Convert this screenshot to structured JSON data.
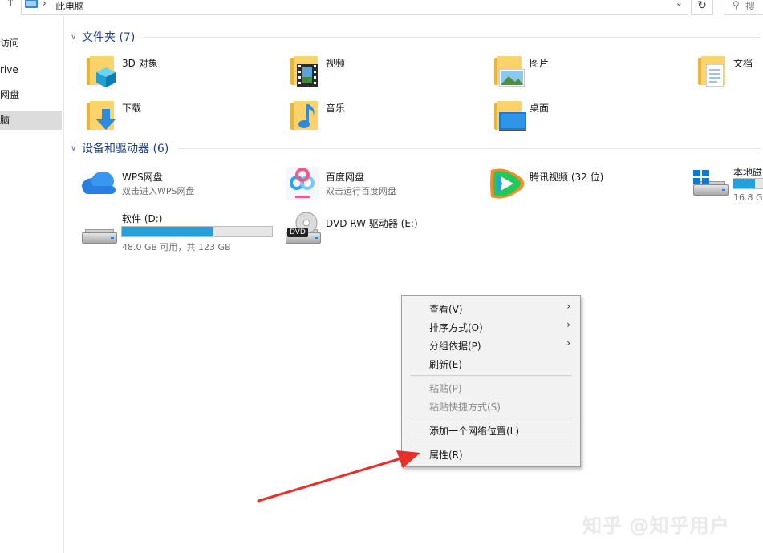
{
  "address": {
    "up_glyph": "↑",
    "separator": "›",
    "location": "此电脑",
    "dropdown_glyph": "⌄",
    "refresh_glyph": "↻",
    "search_glyph": "搜"
  },
  "nav": {
    "items": [
      {
        "label": "访问",
        "selected": false
      },
      {
        "label": "rive",
        "selected": false
      },
      {
        "label": "网盘",
        "selected": false
      },
      {
        "label": "脑",
        "selected": true
      }
    ]
  },
  "folders": {
    "header": "文件夹 (7)",
    "items": [
      {
        "label": "3D 对象",
        "icon": "3d-objects-icon"
      },
      {
        "label": "视频",
        "icon": "videos-icon"
      },
      {
        "label": "图片",
        "icon": "pictures-icon"
      },
      {
        "label": "文档",
        "icon": "documents-icon"
      },
      {
        "label": "下载",
        "icon": "downloads-icon"
      },
      {
        "label": "音乐",
        "icon": "music-icon"
      },
      {
        "label": "桌面",
        "icon": "desktop-icon"
      }
    ]
  },
  "devices": {
    "header": "设备和驱动器 (6)",
    "items": [
      {
        "label": "WPS网盘",
        "sub": "双击进入WPS网盘",
        "icon": "wps-cloud-icon"
      },
      {
        "label": "百度网盘",
        "sub": "双击运行百度网盘",
        "icon": "baidu-netdisk-icon"
      },
      {
        "label": "腾讯视频 (32 位)",
        "sub": "",
        "icon": "tencent-video-icon"
      },
      {
        "label": "本地磁",
        "sub": "16.8 G",
        "icon": "local-disk-icon",
        "used_fraction": 0.7
      },
      {
        "label": "软件 (D:)",
        "sub": "48.0 GB 可用，共 123 GB",
        "icon": "drive-icon",
        "used_fraction": 0.61
      },
      {
        "label": "DVD RW 驱动器 (E:)",
        "sub": "",
        "icon": "dvd-drive-icon",
        "badge": "DVD"
      }
    ]
  },
  "context_menu": {
    "items": [
      {
        "label": "查看(V)",
        "submenu": true,
        "disabled": false
      },
      {
        "label": "排序方式(O)",
        "submenu": true,
        "disabled": false
      },
      {
        "label": "分组依据(P)",
        "submenu": true,
        "disabled": false
      },
      {
        "label": "刷新(E)",
        "submenu": false,
        "disabled": false
      },
      {
        "label": "粘贴(P)",
        "submenu": false,
        "disabled": true
      },
      {
        "label": "粘贴快捷方式(S)",
        "submenu": false,
        "disabled": true
      },
      {
        "label": "添加一个网络位置(L)",
        "submenu": false,
        "disabled": false
      },
      {
        "label": "属性(R)",
        "submenu": false,
        "disabled": false
      }
    ],
    "submenu_glyph": "›"
  },
  "watermark": "知乎 @知乎用户",
  "colors": {
    "accent": "#26a0da",
    "group_title": "#1e3f8a",
    "annotation_arrow": "#e8302a"
  }
}
